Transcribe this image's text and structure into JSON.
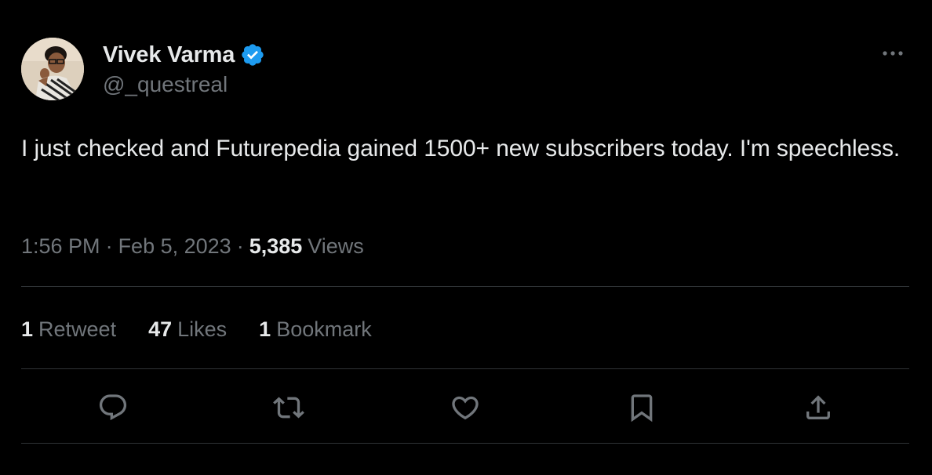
{
  "author": {
    "name": "Vivek Varma",
    "handle": "@_questreal",
    "verified": true,
    "verified_icon": "verified-badge-icon",
    "verified_color": "#1d9bf0",
    "avatar_icon": "avatar-photo"
  },
  "menu": {
    "icon": "more-options-icon"
  },
  "tweet": {
    "text": "I just checked and Futurepedia gained 1500+ new subscribers today. I'm speechless."
  },
  "meta": {
    "time": "1:56 PM",
    "separator": "·",
    "date": "Feb 5, 2023",
    "views_count": "5,385",
    "views_label": "Views"
  },
  "stats": {
    "retweets_count": "1",
    "retweets_label": "Retweet",
    "likes_count": "47",
    "likes_label": "Likes",
    "bookmarks_count": "1",
    "bookmarks_label": "Bookmark"
  },
  "actions": [
    {
      "name": "reply",
      "icon": "reply-icon"
    },
    {
      "name": "retweet",
      "icon": "retweet-icon"
    },
    {
      "name": "like",
      "icon": "heart-icon"
    },
    {
      "name": "bookmark",
      "icon": "bookmark-icon"
    },
    {
      "name": "share",
      "icon": "share-icon"
    }
  ],
  "colors": {
    "background": "#000000",
    "text_primary": "#e7e9ea",
    "text_secondary": "#71767b",
    "divider": "#2f3336",
    "verified": "#1d9bf0"
  }
}
